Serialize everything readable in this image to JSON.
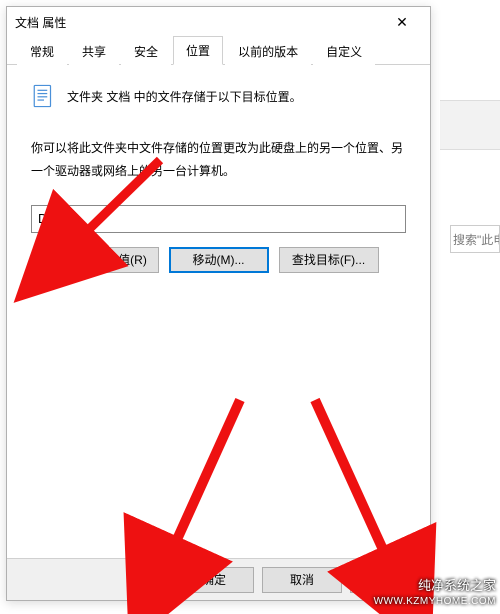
{
  "bg": {
    "search_placeholder": "搜索\"此电"
  },
  "dialog": {
    "title": "文档 属性",
    "close": "✕",
    "tabs": {
      "general": "常规",
      "share": "共享",
      "security": "安全",
      "location": "位置",
      "previous": "以前的版本",
      "custom": "自定义"
    },
    "header_text": "文件夹 文档 中的文件存储于以下目标位置。",
    "description": "你可以将此文件夹中文件存储的位置更改为此硬盘上的另一个位置、另一个驱动器或网络上的另一台计算机。",
    "path_value": "D:\\",
    "buttons": {
      "restore": "还原默认值(R)",
      "move": "移动(M)...",
      "find": "查找目标(F)..."
    },
    "footer": {
      "ok": "确定",
      "cancel": "取消"
    }
  },
  "watermark": {
    "name": "纯净系统之家",
    "url": "WWW.KZMYHOME.COM"
  }
}
